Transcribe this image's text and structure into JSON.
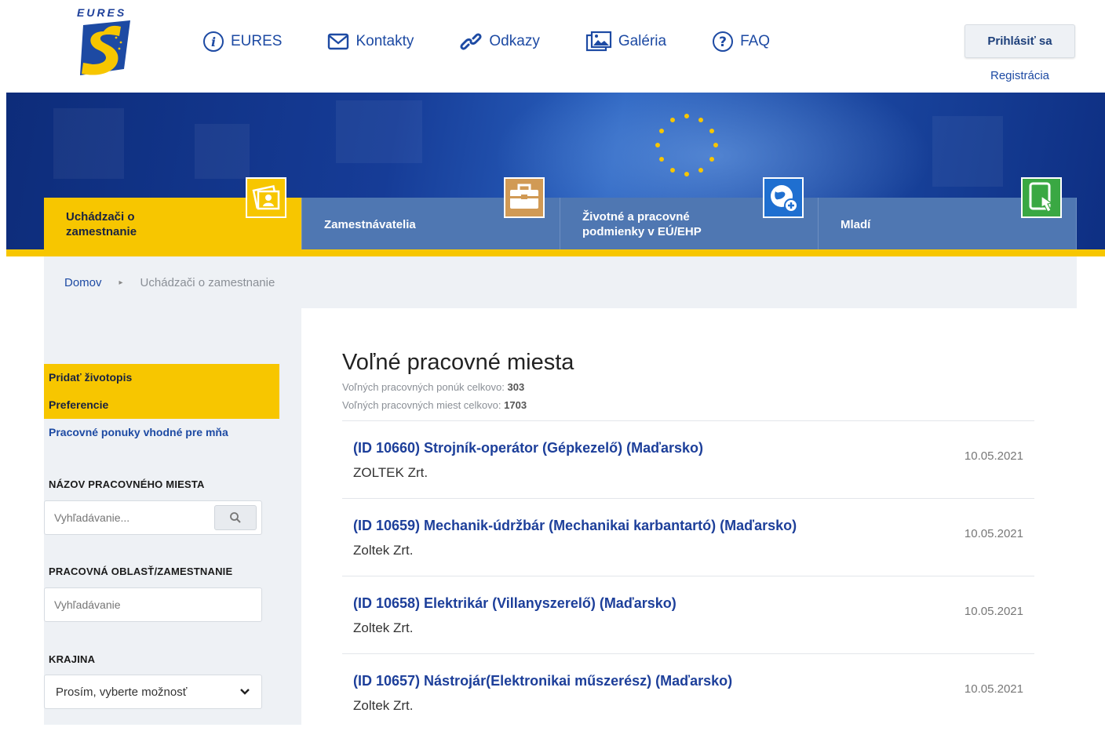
{
  "brand": {
    "logo_text": "EURES",
    "primary": "#1d4aa3",
    "accent": "#f7c600"
  },
  "topnav": [
    {
      "label": "EURES",
      "icon": "info-icon"
    },
    {
      "label": "Kontakty",
      "icon": "envelope-icon"
    },
    {
      "label": "Odkazy",
      "icon": "link-icon"
    },
    {
      "label": "Galéria",
      "icon": "gallery-icon"
    },
    {
      "label": "FAQ",
      "icon": "question-icon"
    }
  ],
  "auth": {
    "login_label": "Prihlásiť sa",
    "register_label": "Registrácia"
  },
  "categories": [
    {
      "label": "Uchádzači o zamestnanie",
      "active": true,
      "icon": "job-seeker-icon"
    },
    {
      "label": "Zamestnávatelia",
      "active": false,
      "icon": "briefcase-icon"
    },
    {
      "label": "Životné a pracovné podmienky v EÚ/EHP",
      "active": false,
      "icon": "globe-icon"
    },
    {
      "label": "Mladí",
      "active": false,
      "icon": "touch-device-icon"
    }
  ],
  "breadcrumb": {
    "home": "Domov",
    "current": "Uchádzači o zamestnanie"
  },
  "sidebar": {
    "links": [
      "Pridať životopis",
      "Preferencie",
      "Pracovné ponuky vhodné pre mňa"
    ],
    "job_title_label": "NÁZOV PRACOVNÉHO MIESTA",
    "job_title_placeholder": "Vyhľadávanie...",
    "area_label": "PRACOVNÁ OBLASŤ/ZAMESTNANIE",
    "area_placeholder": "Vyhľadávanie",
    "country_label": "KRAJINA",
    "country_selected": "Prosím, vyberte možnosť"
  },
  "listing": {
    "title": "Voľné pracovné miesta",
    "offers_label": "Voľných pracovných ponúk celkovo:",
    "offers_count": "303",
    "positions_label": "Voľných pracovných miest celkovo:",
    "positions_count": "1703",
    "jobs": [
      {
        "title": "(ID 10660) Strojník-operátor (Gépkezelő) (Maďarsko)",
        "company": "ZOLTEK Zrt.",
        "date": "10.05.2021"
      },
      {
        "title": "(ID 10659) Mechanik-údržbár (Mechanikai karbantartó) (Maďarsko)",
        "company": "Zoltek Zrt.",
        "date": "10.05.2021"
      },
      {
        "title": "(ID 10658) Elektrikár (Villanyszerelő) (Maďarsko)",
        "company": "Zoltek Zrt.",
        "date": "10.05.2021"
      },
      {
        "title": "(ID 10657) Nástrojár(Elektronikai műszerész) (Maďarsko)",
        "company": "Zoltek Zrt.",
        "date": "10.05.2021"
      }
    ]
  }
}
